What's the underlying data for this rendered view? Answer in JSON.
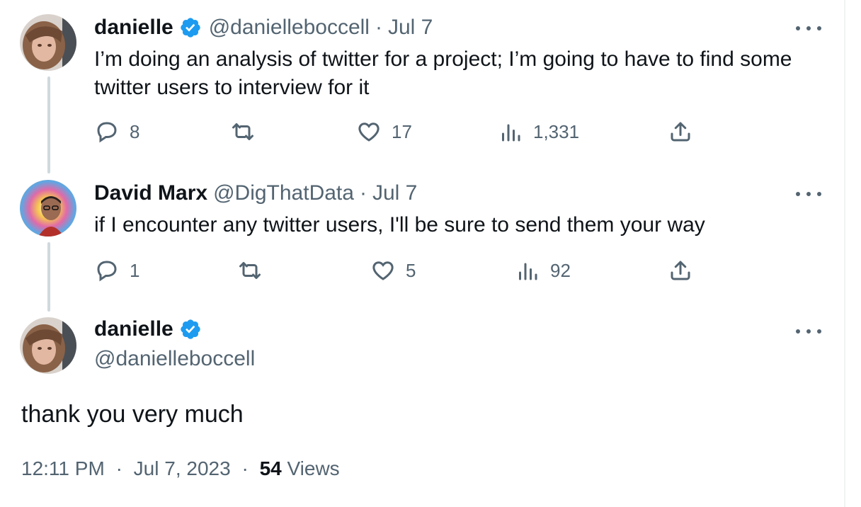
{
  "colors": {
    "accent": "#1d9bf0",
    "muted": "#536471",
    "text": "#0f1419",
    "thread_line": "#cfd9de"
  },
  "tweet1": {
    "name": "danielle",
    "verified": true,
    "handle": "@danielleboccell",
    "separator": "·",
    "date": "Jul 7",
    "text": "I’m doing an analysis of twitter for a project; I’m going to have to find some twitter users to interview for it",
    "replies": "8",
    "likes": "17",
    "views": "1,331",
    "icons": [
      "reply-icon",
      "retweet-icon",
      "like-icon",
      "views-icon",
      "share-icon",
      "more-icon"
    ]
  },
  "tweet2": {
    "name": "David Marx",
    "handle": "@DigThatData",
    "separator": "·",
    "date": "Jul 7",
    "text": "if I encounter any twitter users, I'll be sure to send them your way",
    "replies": "1",
    "likes": "5",
    "views": "92"
  },
  "main": {
    "name": "danielle",
    "verified": true,
    "handle": "@danielleboccell",
    "text": "thank you very much",
    "time": "12:11 PM",
    "separator": "·",
    "date": "Jul 7, 2023",
    "views_count": "54",
    "views_label": "Views"
  }
}
